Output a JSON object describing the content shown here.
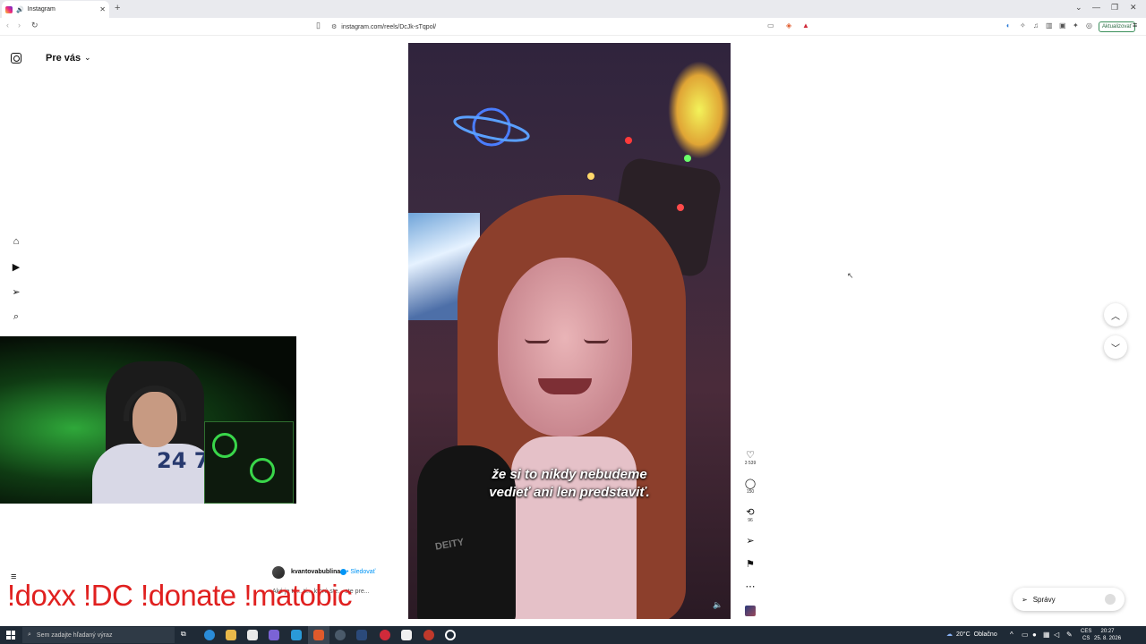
{
  "browser": {
    "tab_title": "Instagram",
    "new_tab_icon": "plus-icon",
    "url": "instagram.com/reels/DcJk-sTqpol/",
    "update_label": "Aktualizovať"
  },
  "sidebar": {
    "feed_title": "Pre vás",
    "icons": [
      "home-icon",
      "reels-icon",
      "send-icon",
      "search-icon",
      "menu-icon"
    ]
  },
  "reel": {
    "caption_line1": "že si to nikdy nebudeme",
    "caption_line2": "vedieť ani len predstaviť.",
    "mic_text": "DEITY",
    "shirt_number": "24 7"
  },
  "actions": {
    "likes": "3 539",
    "comments": "150",
    "reposts": "96"
  },
  "author": {
    "name": "kvantovabublina",
    "follow_label": "• Sledovať",
    "post_text": "Aké je to... tí... ktorú ste... ste pre..."
  },
  "overlay": {
    "text": "!doxx  !DC !donate !matobic"
  },
  "messages_label": "Správy",
  "taskbar": {
    "search_placeholder": "Sem zadajte hľadaný výraz",
    "temperature": "20°C",
    "weather": "Oblačno",
    "lang1": "CES",
    "lang2": "CS",
    "time": "20:27",
    "date": "25. 8. 2026"
  },
  "colors": {
    "overlay_red": "#e0201f",
    "accent_blue": "#0095f6",
    "taskbar": "#1f2a36"
  }
}
